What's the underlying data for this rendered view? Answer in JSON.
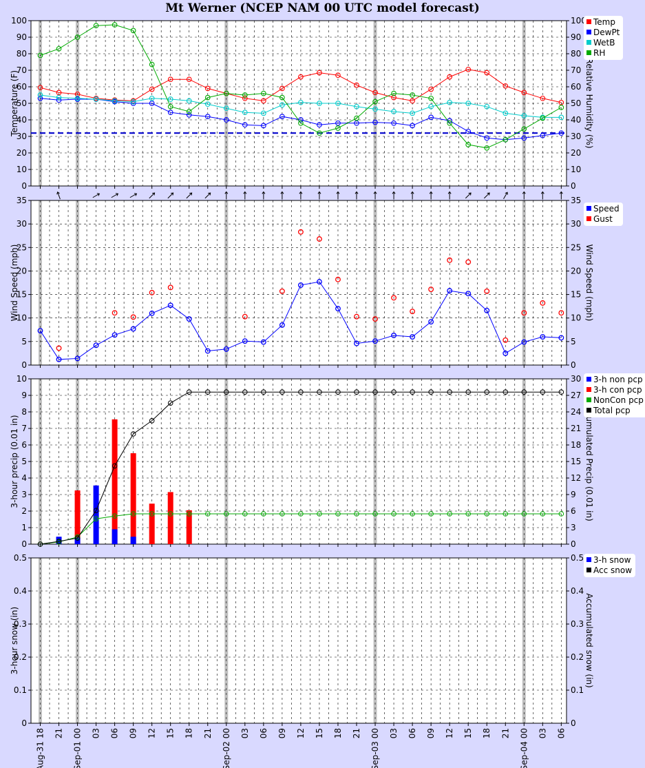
{
  "title": "Mt Werner (NCEP NAM 00 UTC model forecast)",
  "time_axis": {
    "hour_labels": [
      "18",
      "21",
      "00",
      "03",
      "06",
      "09",
      "12",
      "15",
      "18",
      "21",
      "00",
      "03",
      "06",
      "09",
      "12",
      "15",
      "18",
      "21",
      "00",
      "03",
      "06",
      "09",
      "12",
      "15",
      "18",
      "21",
      "00",
      "03",
      "06"
    ],
    "date_labels": [
      {
        "index": 0,
        "text": "Aug-31"
      },
      {
        "index": 2,
        "text": "Sep-01"
      },
      {
        "index": 10,
        "text": "Sep-02"
      },
      {
        "index": 18,
        "text": "Sep-03"
      },
      {
        "index": 26,
        "text": "Sep-04"
      }
    ]
  },
  "wind_direction_arrows_deg": [
    null,
    160,
    null,
    240,
    240,
    240,
    225,
    225,
    225,
    225,
    180,
    180,
    180,
    180,
    180,
    180,
    180,
    180,
    180,
    180,
    180,
    180,
    180,
    225,
    225,
    210,
    180,
    180,
    180
  ],
  "legends": {
    "temp": [
      {
        "label": "Temp",
        "color": "#ff0000"
      },
      {
        "label": "DewPt",
        "color": "#0000ff"
      },
      {
        "label": "WetB",
        "color": "#00cccc"
      },
      {
        "label": "RH",
        "color": "#00aa00"
      }
    ],
    "wind": [
      {
        "label": "Speed",
        "color": "#0000ff"
      },
      {
        "label": "Gust",
        "color": "#ff0000"
      }
    ],
    "precip": [
      {
        "label": "3-h non pcp",
        "color": "#0000ff"
      },
      {
        "label": "3-h con pcp",
        "color": "#ff0000"
      },
      {
        "label": "NonCon pcp",
        "color": "#00aa00"
      },
      {
        "label": "Total pcp",
        "color": "#000000"
      }
    ],
    "snow": [
      {
        "label": "3-h snow",
        "color": "#0000ff"
      },
      {
        "label": "Acc snow",
        "color": "#000000"
      }
    ]
  },
  "chart_data": [
    {
      "type": "line",
      "panel": "temperature",
      "ylabel": "Temperature (F)",
      "y2label": "Relative Humidity (%)",
      "ylim": [
        0,
        100
      ],
      "y2lim": [
        0,
        100
      ],
      "yticks": [
        0,
        10,
        20,
        30,
        40,
        50,
        60,
        70,
        80,
        90,
        100
      ],
      "reference_line": 32,
      "series": [
        {
          "name": "Temp",
          "color": "#ff0000",
          "values": [
            59.5,
            56.5,
            55.5,
            53,
            52,
            51.5,
            58.5,
            64.5,
            64.5,
            59,
            56,
            53,
            51.5,
            59,
            66,
            68.5,
            67,
            61,
            56.5,
            53.5,
            51.5,
            58.5,
            66,
            70.5,
            68.5,
            60.5,
            56.5,
            53,
            50.5
          ]
        },
        {
          "name": "DewPt",
          "color": "#0000ff",
          "values": [
            53,
            52,
            52.5,
            52.5,
            51,
            50,
            50,
            44.5,
            43,
            42,
            40,
            37,
            36.5,
            42,
            40,
            37,
            38,
            38,
            38.5,
            38,
            36.5,
            41.5,
            39.5,
            33,
            29,
            28,
            29,
            30.5,
            32
          ]
        },
        {
          "name": "WetB",
          "color": "#00cccc",
          "values": [
            55,
            53.5,
            53,
            52.5,
            51.5,
            51,
            53,
            52.5,
            51.5,
            49.5,
            47,
            44.5,
            44,
            49,
            50.5,
            50,
            50,
            48,
            46.5,
            45,
            44,
            48,
            50.5,
            50,
            48,
            44,
            42.5,
            41.5,
            41.5
          ]
        },
        {
          "name": "RH",
          "color": "#00aa00",
          "axis": "right",
          "values": [
            79,
            83,
            90,
            97,
            97.5,
            94,
            73.5,
            48,
            45,
            53.5,
            56,
            55,
            56,
            53.5,
            38,
            32,
            35,
            41,
            51,
            56,
            55,
            53,
            38,
            25,
            23,
            28,
            34.5,
            41,
            47.5
          ]
        }
      ]
    },
    {
      "type": "line",
      "panel": "wind",
      "ylabel": "Wind Speed (mph)",
      "y2label": "Wind Speed (mph)",
      "ylim": [
        0,
        35
      ],
      "yticks": [
        0,
        5,
        10,
        15,
        20,
        25,
        30,
        35
      ],
      "series": [
        {
          "name": "Speed",
          "color": "#0000ff",
          "values": [
            7.3,
            1.2,
            1.4,
            4.2,
            6.4,
            7.7,
            11,
            12.7,
            9.8,
            3,
            3.4,
            5.1,
            4.9,
            8.5,
            17,
            17.7,
            12,
            4.6,
            5.1,
            6.3,
            6,
            9.2,
            15.8,
            15.2,
            11.6,
            2.5,
            4.9,
            6,
            5.8
          ]
        },
        {
          "name": "Gust",
          "color": "#ff0000",
          "markers_only": true,
          "values": [
            null,
            3.6,
            null,
            null,
            11.1,
            10.2,
            15.4,
            16.5,
            null,
            null,
            null,
            10.3,
            null,
            15.7,
            28.3,
            26.8,
            18.2,
            10.3,
            9.8,
            14.3,
            11.4,
            16.1,
            22.3,
            21.9,
            15.7,
            5.3,
            11.1,
            13.2,
            11.1
          ]
        }
      ]
    },
    {
      "type": "bar",
      "panel": "precipitation",
      "ylabel": "3-hour precip (0.01 in)",
      "y2label": "Accumulated Precip (0.01 in)",
      "ylim": [
        0,
        10
      ],
      "y2lim": [
        0,
        30
      ],
      "yticks": [
        0,
        1,
        2,
        3,
        4,
        5,
        6,
        7,
        8,
        9,
        10
      ],
      "y2ticks": [
        0,
        3,
        6,
        9,
        12,
        15,
        18,
        21,
        24,
        27,
        30
      ],
      "series": [
        {
          "name": "3-h non pcp",
          "color": "#0000ff",
          "values": [
            0,
            0.45,
            0.4,
            3.55,
            0.9,
            0.45,
            0,
            0,
            0,
            0,
            0,
            0,
            0,
            0,
            0,
            0,
            0,
            0,
            0,
            0,
            0,
            0,
            0,
            0,
            0,
            0,
            0,
            0,
            0
          ]
        },
        {
          "name": "3-h con pcp",
          "color": "#ff0000",
          "values": [
            0,
            0,
            3.25,
            0,
            7.55,
            5.5,
            2.45,
            3.15,
            2.05,
            0,
            0,
            0,
            0,
            0,
            0,
            0,
            0,
            0,
            0,
            0,
            0,
            0,
            0,
            0,
            0,
            0,
            0,
            0,
            0
          ]
        },
        {
          "name": "NonCon pcp",
          "color": "#00aa00",
          "axis": "right",
          "values": [
            0,
            0.4,
            1.3,
            4.6,
            5.1,
            5.5,
            5.5,
            5.5,
            5.5,
            5.5,
            5.5,
            5.5,
            5.5,
            5.5,
            5.5,
            5.5,
            5.5,
            5.5,
            5.5,
            5.5,
            5.5,
            5.5,
            5.5,
            5.5,
            5.5,
            5.5,
            5.5,
            5.5,
            5.5
          ]
        },
        {
          "name": "Total pcp",
          "color": "#000000",
          "axis": "right",
          "values": [
            0,
            0.5,
            1.1,
            6.1,
            14.2,
            20,
            22.4,
            25.6,
            27.6,
            27.6,
            27.6,
            27.6,
            27.6,
            27.6,
            27.6,
            27.6,
            27.6,
            27.6,
            27.6,
            27.6,
            27.6,
            27.6,
            27.6,
            27.6,
            27.6,
            27.6,
            27.6,
            27.6,
            27.6
          ]
        }
      ]
    },
    {
      "type": "bar",
      "panel": "snow",
      "ylabel": "3-hour snow (in)",
      "y2label": "Accumulated snow (in)",
      "ylim": [
        0,
        0.5
      ],
      "yticks": [
        0,
        0.1,
        0.2,
        0.3,
        0.4,
        0.5
      ],
      "ytick_labels": [
        "0",
        "0.1",
        "0.2",
        "0.3",
        "0.4",
        "0.5"
      ],
      "series": [
        {
          "name": "3-h snow",
          "color": "#0000ff",
          "values": []
        },
        {
          "name": "Acc snow",
          "color": "#000000",
          "values": []
        }
      ]
    }
  ]
}
